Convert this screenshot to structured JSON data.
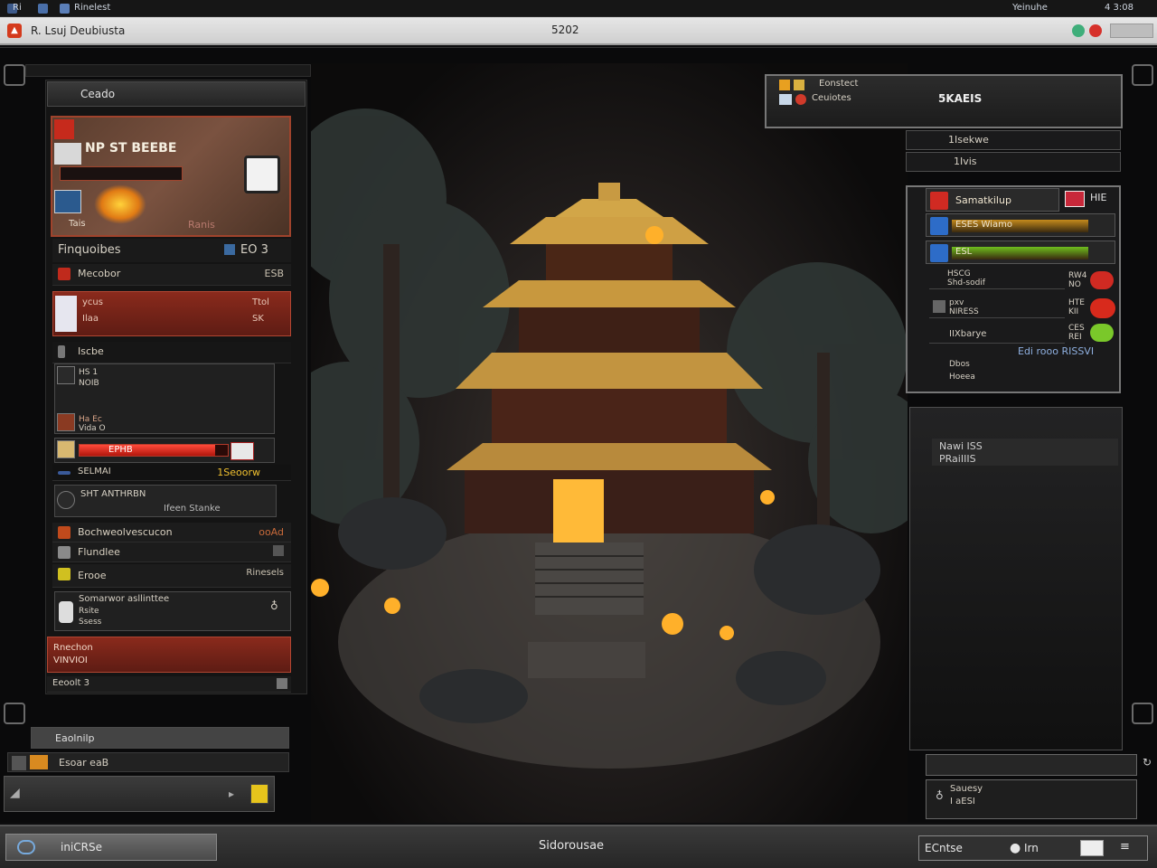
{
  "os_bar": {
    "left_label": "Ri",
    "app_label": "Rinelest",
    "right_label": "Yeinuhe",
    "right_stat": "4 3:08"
  },
  "window": {
    "title": "R. Lsuj Deubiusta",
    "center_label": "5202"
  },
  "left_panel": {
    "header": "Ceado",
    "portrait": {
      "name": "NP ST BEEBE",
      "sub": "Tais",
      "note": "Ranis"
    },
    "section_title": "Finquoibes",
    "section_value": "EO 3",
    "row1": {
      "label": "Mecobor",
      "value": "ESB"
    },
    "redbox": {
      "line1": "ycus",
      "line2": "Ilaa",
      "v1": "Ttol",
      "v2": "SK"
    },
    "list_title": "Iscbe",
    "entries": [
      {
        "l1": "HS 1",
        "l2": "NOIB"
      },
      {
        "l1": "Ha Ec",
        "l2": "Vida O"
      }
    ],
    "healthbar_label": "EPHB",
    "stat_row": {
      "label": "SELMAI",
      "value": "1Seoorw"
    },
    "event": {
      "title": "SHT ANTHRBN",
      "sub": "Ifeen Stanke"
    },
    "menu": [
      {
        "label": "Bochweolvescucon",
        "value": "ooAd"
      },
      {
        "label": "Flundlee",
        "value": ""
      },
      {
        "label": "Erooe",
        "value": "Rinesels"
      }
    ],
    "quest": {
      "title": "Somarwor asllinttee",
      "l2": "Rsite",
      "l3": "Ssess"
    },
    "red_footer": {
      "l1": "Rnechon",
      "l2": "VINVIOI"
    },
    "footer_row": "Eeoolt 3",
    "sub_header": "Eaolnilp",
    "sub_row": "Esoar eaB"
  },
  "right_top": {
    "label1": "Eonstect",
    "label2": "Ceuiotes",
    "center": "5KAEIS",
    "row1": "1Isekwe",
    "row2": "1Ivis"
  },
  "right_status": {
    "title": "Samatkilup",
    "badge": "HIE",
    "bars": [
      {
        "label": "ESES Wiamo",
        "color": "#c58a1c",
        "fill": 0.86
      },
      {
        "label": "ESL",
        "color": "#6fbf1e",
        "fill": 0.86
      }
    ],
    "entries": [
      {
        "l1": "HSCG",
        "l2": "Shd-sodif",
        "v1": "RW4",
        "v2": "NO"
      },
      {
        "l1": "pxv",
        "l2": "NIRESS",
        "v1": "HTE",
        "v2": "KII"
      },
      {
        "l1": "IIXbarye",
        "l2": "",
        "v1": "CES",
        "v2": "REI"
      }
    ],
    "link": "Edi rooo RISSVI",
    "foot1": "Dbos",
    "foot2": "Hoeea"
  },
  "right_info": {
    "l1": "Nawi ISS",
    "l2": "PRaiIIIS"
  },
  "right_bottom": {
    "label": "Sauesy",
    "sub": "I aESI"
  },
  "bottom": {
    "left_button": "iniCRSe",
    "center": "Sidorousae",
    "right_label": "ECntse",
    "right_label2": "Irn"
  },
  "colors": {
    "accent_red": "#a0432c",
    "frame": "#4e4e4e",
    "health": "#d32a1c"
  }
}
